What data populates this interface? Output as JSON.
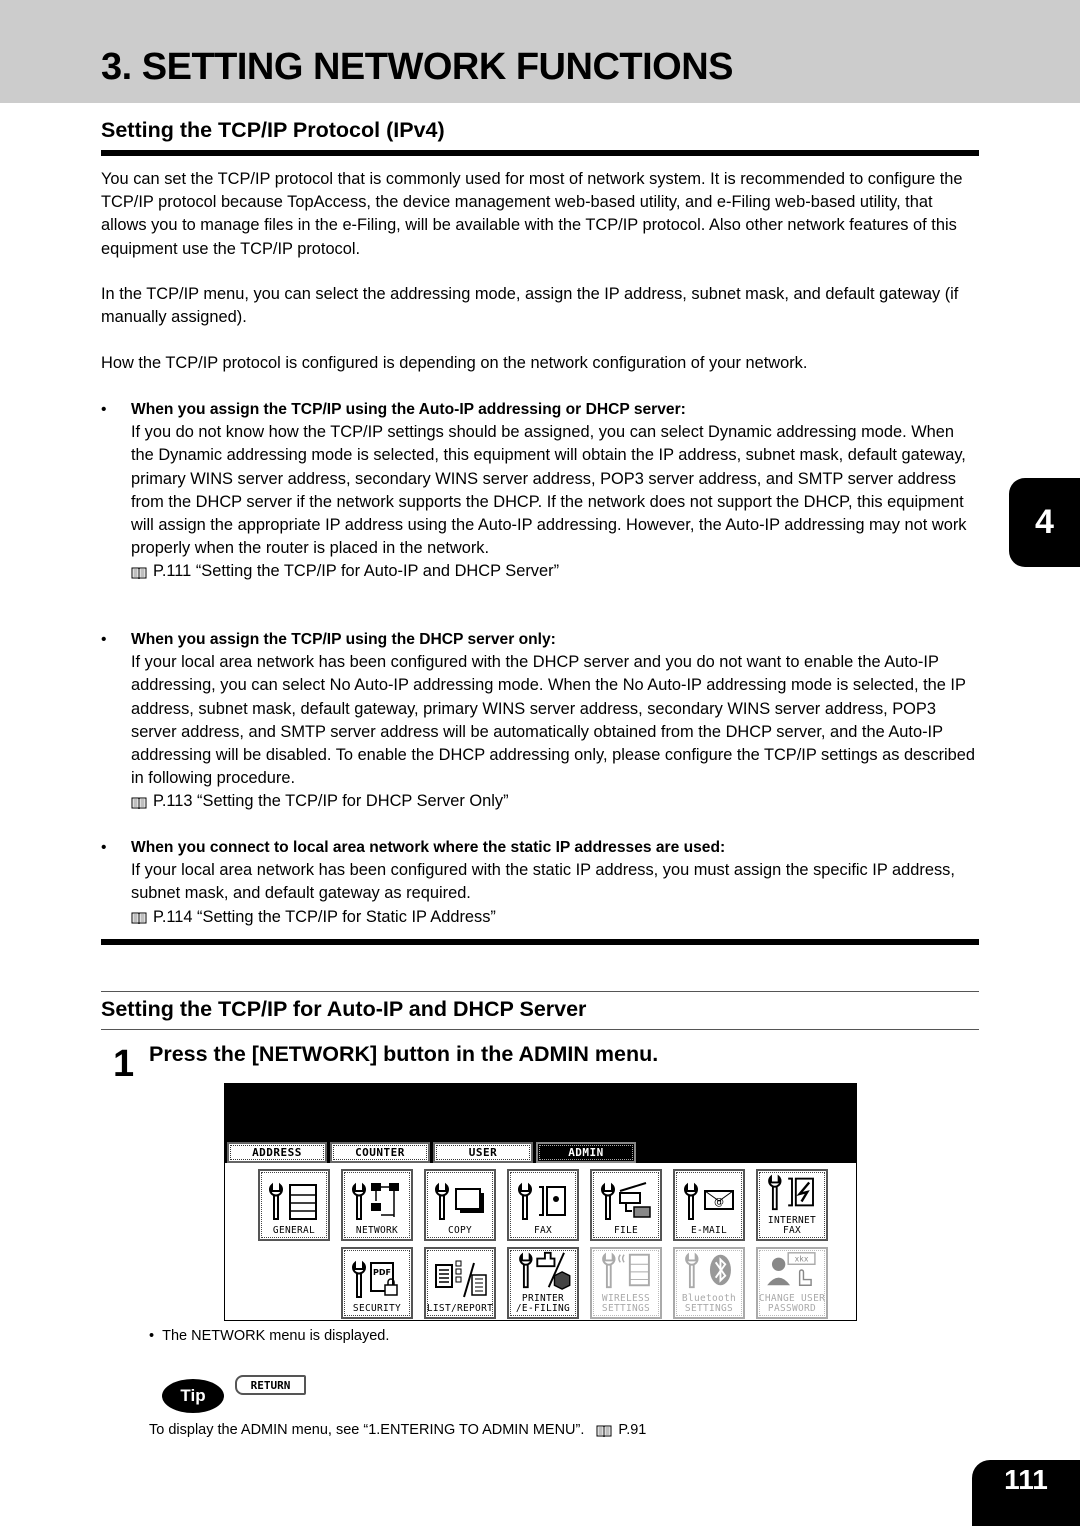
{
  "header": {
    "chapter_title": "3. SETTING NETWORK FUNCTIONS"
  },
  "section1": {
    "title": "Setting the TCP/IP Protocol (IPv4)",
    "paragraphs": [
      "You can set the TCP/IP protocol that is commonly used for most of network system.  It is recommended to configure the TCP/IP protocol because TopAccess, the device management web-based utility, and e-Filing web-based utility, that allows you to manage files in the e-Filing, will be available with the TCP/IP protocol. Also other network features of this equipment use the TCP/IP protocol.",
      "In the TCP/IP menu, you can select the addressing mode, assign the IP address, subnet mask, and default gateway (if manually assigned).",
      "How the TCP/IP protocol is configured is depending on the network configuration of your network."
    ],
    "bullets": [
      {
        "heading": "When you assign the TCP/IP using the Auto-IP addressing or DHCP server:",
        "body": "If you do not know how the TCP/IP settings should be assigned, you can select Dynamic addressing mode.  When the Dynamic addressing mode is selected, this equipment will obtain the IP address, subnet mask, default gateway, primary WINS server address, secondary WINS server address, POP3 server address, and SMTP server address from the DHCP server if the network supports the DHCP.  If the network does not support the DHCP, this equipment will assign the appropriate IP address using the Auto-IP addressing.  However, the Auto-IP addressing may not work properly when the router is placed in the network.",
        "ref": "P.111 “Setting the TCP/IP for Auto-IP and DHCP Server”"
      },
      {
        "heading": "When you assign the TCP/IP using the DHCP server only:",
        "body": "If your local area network has been configured with the DHCP server and you do not want to enable the Auto-IP addressing, you can select No Auto-IP addressing mode.  When the No Auto-IP addressing mode is selected, the IP address, subnet mask, default gateway, primary WINS server address, secondary WINS server address, POP3 server address, and SMTP server address will be automatically obtained from the DHCP server, and the Auto-IP addressing will be disabled.  To enable the DHCP addressing only, please configure the TCP/IP settings as described in following procedure.",
        "ref": "P.113 “Setting the TCP/IP for DHCP Server Only”"
      },
      {
        "heading": "When you connect to local area network where the static IP addresses are used:",
        "body": "If your local area network has been configured with the static IP address, you must assign the specific IP address, subnet mask, and default gateway as required.",
        "ref": "P.114 “Setting the TCP/IP for Static IP Address”"
      }
    ]
  },
  "section2": {
    "title": "Setting the TCP/IP for Auto-IP and DHCP Server",
    "step_number": "1",
    "step_text": "Press the [NETWORK] button in the ADMIN menu.",
    "note_bullet": "•",
    "note": "The NETWORK menu is displayed.",
    "tip_label": "Tip",
    "tip_text": "To display the ADMIN menu, see “1.ENTERING TO ADMIN MENU”.",
    "tip_ref": "P.91"
  },
  "panel": {
    "tabs": [
      {
        "label": "ADDRESS",
        "active": false
      },
      {
        "label": "COUNTER",
        "active": false
      },
      {
        "label": "USER",
        "active": false
      },
      {
        "label": "ADMIN",
        "active": true
      }
    ],
    "buttons": [
      {
        "label": "GENERAL",
        "icon": "general-icon",
        "enabled": true
      },
      {
        "label": "NETWORK",
        "icon": "network-icon",
        "enabled": true
      },
      {
        "label": "COPY",
        "icon": "copy-icon",
        "enabled": true
      },
      {
        "label": "FAX",
        "icon": "fax-icon",
        "enabled": true
      },
      {
        "label": "FILE",
        "icon": "file-icon",
        "enabled": true
      },
      {
        "label": "E-MAIL",
        "icon": "email-icon",
        "enabled": true
      },
      {
        "label": "INTERNET FAX",
        "icon": "internet-fax-icon",
        "enabled": true
      },
      {
        "label": "SECURITY",
        "icon": "security-icon",
        "enabled": true
      },
      {
        "label": "LIST/REPORT",
        "icon": "list-report-icon",
        "enabled": true
      },
      {
        "label": "PRINTER\n/E-FILING",
        "icon": "printer-efiling-icon",
        "enabled": true
      },
      {
        "label": "WIRELESS\nSETTINGS",
        "icon": "wireless-icon",
        "enabled": false
      },
      {
        "label": "Bluetooth\nSETTINGS",
        "icon": "bluetooth-icon",
        "enabled": false
      },
      {
        "label": "CHANGE USER\nPASSWORD",
        "icon": "change-password-icon",
        "enabled": false
      }
    ],
    "return_label": "RETURN"
  },
  "side_tab": {
    "chapter_number": "4"
  },
  "footer": {
    "page_number": "111"
  }
}
